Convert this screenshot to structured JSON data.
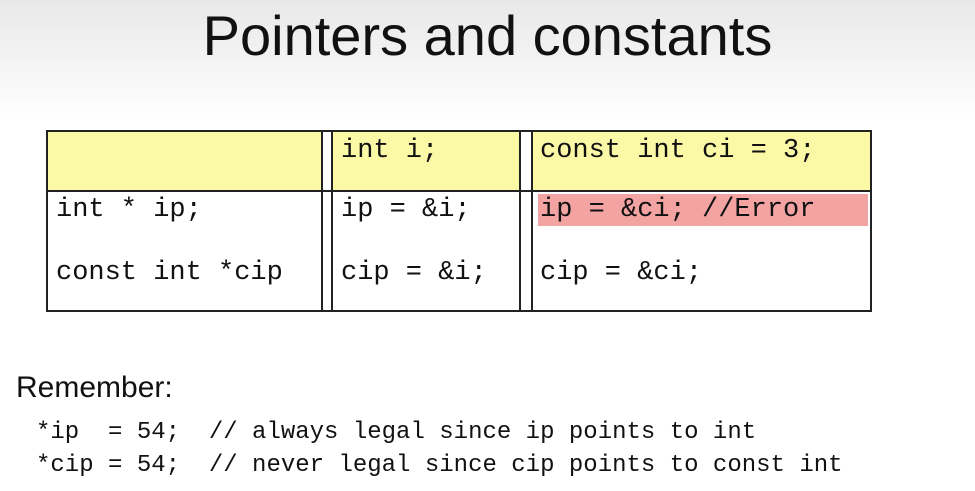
{
  "title": "Pointers and constants",
  "table": {
    "header": [
      "",
      "int i;",
      "const int ci = 3;"
    ],
    "rows": [
      [
        "int * ip;",
        "ip = &i;",
        "ip = &ci; //Error"
      ],
      [
        "const int *cip",
        "cip = &i;",
        "cip = &ci;"
      ]
    ],
    "error_highlight_color": "#f4a3a3",
    "header_color": "#fbf8a6"
  },
  "remember": {
    "heading": "Remember:",
    "lines": [
      "*ip  = 54;  // always legal since ip points to int",
      "*cip = 54;  // never legal since cip points to const int"
    ]
  }
}
